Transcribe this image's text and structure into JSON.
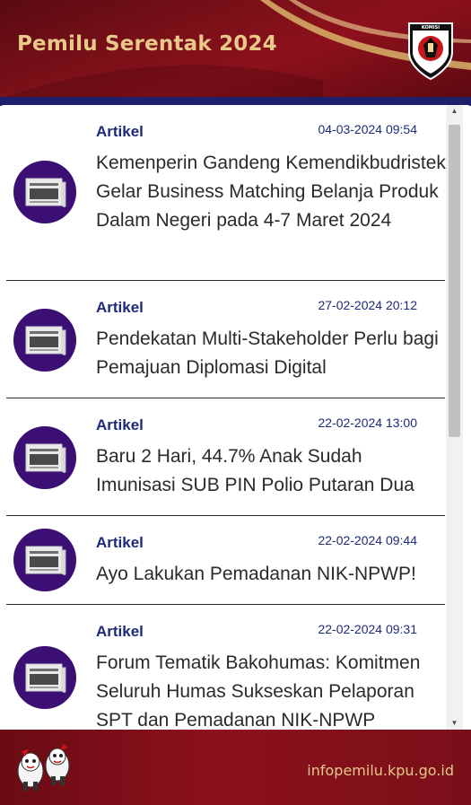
{
  "header": {
    "title": "Pemilu Serentak 2024",
    "logo_text": "KOMISI PEMILIHAN UMUM"
  },
  "articles": [
    {
      "category": "Artikel",
      "date": "04-03-2024 09:54",
      "title": "Kemenperin Gandeng Kemendikbudristek Gelar Business Matching Belanja Produk Dalam Negeri pada 4-7 Maret 2024",
      "icon": "newspaper-icon"
    },
    {
      "category": "Artikel",
      "date": "27-02-2024 20:12",
      "title": "Pendekatan Multi-Stakeholder Perlu bagi Pemajuan Diplomasi Digital",
      "icon": "newspaper-icon"
    },
    {
      "category": "Artikel",
      "date": "22-02-2024 13:00",
      "title": "Baru 2 Hari, 44.7% Anak Sudah Imunisasi SUB PIN Polio Putaran Dua",
      "icon": "newspaper-icon"
    },
    {
      "category": "Artikel",
      "date": "22-02-2024 09:44",
      "title": "Ayo Lakukan Pemadanan NIK-NPWP!",
      "icon": "newspaper-icon"
    },
    {
      "category": "Artikel",
      "date": "22-02-2024 09:31",
      "title": "Forum Tematik Bakohumas: Komitmen Seluruh Humas Suksesk­an Pelaporan SPT dan Pemadanan NIK-NPWP",
      "icon": "newspaper-icon"
    }
  ],
  "footer": {
    "url": "infopemilu.kpu.go.id"
  },
  "colors": {
    "brand_red": "#8d111c",
    "accent_gold": "#e8c98a",
    "navy": "#1d2a78",
    "thumb_purple": "#3b0f73"
  }
}
